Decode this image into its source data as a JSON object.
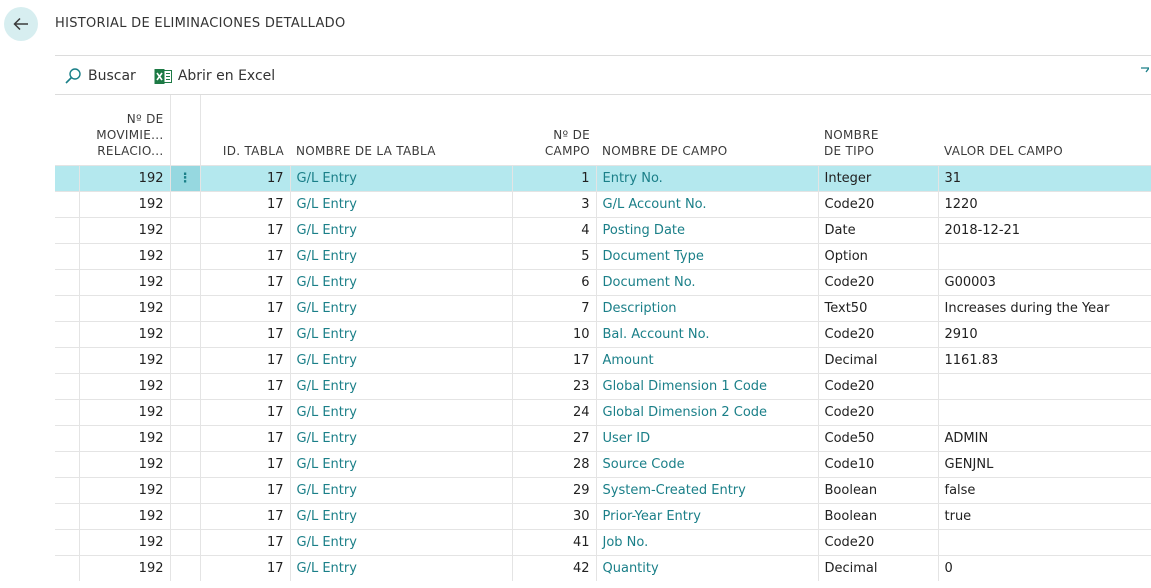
{
  "page": {
    "title": "HISTORIAL DE ELIMINACIONES DETALLADO"
  },
  "toolbar": {
    "search_label": "Buscar",
    "excel_label": "Abrir en Excel"
  },
  "icons": {
    "back": "back-arrow-icon",
    "search": "search-icon",
    "excel": "excel-icon",
    "filter": "filter-icon",
    "row_menu": "vertical-ellipsis-icon"
  },
  "colors": {
    "accent": "#1a7f88",
    "selected_row": "#b4e8ee",
    "back_button_bg": "#d7eef0"
  },
  "table": {
    "headers": {
      "mov_line1": "Nº DE",
      "mov_line2": "MOVIMIE...",
      "mov_line3": "RELACIO...",
      "table_id": "ID. TABLA",
      "table_name": "NOMBRE DE LA TABLA",
      "field_no_line1": "Nº DE",
      "field_no_line2": "CAMPO",
      "field_name": "NOMBRE DE CAMPO",
      "type_line1": "NOMBRE",
      "type_line2": "DE TIPO",
      "value": "VALOR DEL CAMPO"
    },
    "row_menu_glyph": "⋮",
    "rows": [
      {
        "mov": "192",
        "table_id": "17",
        "table_name": "G/L Entry",
        "field_no": "1",
        "field_name": "Entry No.",
        "type": "Integer",
        "value": "31"
      },
      {
        "mov": "192",
        "table_id": "17",
        "table_name": "G/L Entry",
        "field_no": "3",
        "field_name": "G/L Account No.",
        "type": "Code20",
        "value": "1220"
      },
      {
        "mov": "192",
        "table_id": "17",
        "table_name": "G/L Entry",
        "field_no": "4",
        "field_name": "Posting Date",
        "type": "Date",
        "value": "2018-12-21"
      },
      {
        "mov": "192",
        "table_id": "17",
        "table_name": "G/L Entry",
        "field_no": "5",
        "field_name": "Document Type",
        "type": "Option",
        "value": ""
      },
      {
        "mov": "192",
        "table_id": "17",
        "table_name": "G/L Entry",
        "field_no": "6",
        "field_name": "Document No.",
        "type": "Code20",
        "value": "G00003"
      },
      {
        "mov": "192",
        "table_id": "17",
        "table_name": "G/L Entry",
        "field_no": "7",
        "field_name": "Description",
        "type": "Text50",
        "value": "Increases during the Year"
      },
      {
        "mov": "192",
        "table_id": "17",
        "table_name": "G/L Entry",
        "field_no": "10",
        "field_name": "Bal. Account No.",
        "type": "Code20",
        "value": "2910"
      },
      {
        "mov": "192",
        "table_id": "17",
        "table_name": "G/L Entry",
        "field_no": "17",
        "field_name": "Amount",
        "type": "Decimal",
        "value": "1161.83"
      },
      {
        "mov": "192",
        "table_id": "17",
        "table_name": "G/L Entry",
        "field_no": "23",
        "field_name": "Global Dimension 1 Code",
        "type": "Code20",
        "value": ""
      },
      {
        "mov": "192",
        "table_id": "17",
        "table_name": "G/L Entry",
        "field_no": "24",
        "field_name": "Global Dimension 2 Code",
        "type": "Code20",
        "value": ""
      },
      {
        "mov": "192",
        "table_id": "17",
        "table_name": "G/L Entry",
        "field_no": "27",
        "field_name": "User ID",
        "type": "Code50",
        "value": "ADMIN"
      },
      {
        "mov": "192",
        "table_id": "17",
        "table_name": "G/L Entry",
        "field_no": "28",
        "field_name": "Source Code",
        "type": "Code10",
        "value": "GENJNL"
      },
      {
        "mov": "192",
        "table_id": "17",
        "table_name": "G/L Entry",
        "field_no": "29",
        "field_name": "System-Created Entry",
        "type": "Boolean",
        "value": "false"
      },
      {
        "mov": "192",
        "table_id": "17",
        "table_name": "G/L Entry",
        "field_no": "30",
        "field_name": "Prior-Year Entry",
        "type": "Boolean",
        "value": "true"
      },
      {
        "mov": "192",
        "table_id": "17",
        "table_name": "G/L Entry",
        "field_no": "41",
        "field_name": "Job No.",
        "type": "Code20",
        "value": ""
      },
      {
        "mov": "192",
        "table_id": "17",
        "table_name": "G/L Entry",
        "field_no": "42",
        "field_name": "Quantity",
        "type": "Decimal",
        "value": "0"
      }
    ]
  }
}
